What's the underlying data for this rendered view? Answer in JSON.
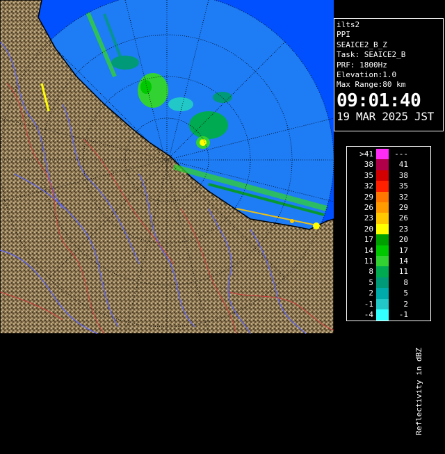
{
  "header": {
    "lines": [
      "ilts2",
      "PPI",
      "SEAICE2_B_Z",
      "Task: SEAICE2_B",
      "PRF: 1800Hz",
      "Elevation:1.0",
      "Max Range:80 km"
    ],
    "time": "09:01:40",
    "date": "19 MAR 2025 JST"
  },
  "legend": {
    "unit_label": "Reflectivity in dBZ",
    "rows": [
      {
        "low": ">41",
        "high": "---",
        "color": "#ff2cf5"
      },
      {
        "low": "38",
        "high": "41",
        "color": "#b0004a"
      },
      {
        "low": "35",
        "high": "38",
        "color": "#d20000"
      },
      {
        "low": "32",
        "high": "35",
        "color": "#ff2000"
      },
      {
        "low": "29",
        "high": "32",
        "color": "#ff7700"
      },
      {
        "low": "26",
        "high": "29",
        "color": "#ff9a00"
      },
      {
        "low": "23",
        "high": "26",
        "color": "#ffc800"
      },
      {
        "low": "20",
        "high": "23",
        "color": "#ffff00"
      },
      {
        "low": "17",
        "high": "20",
        "color": "#00a000"
      },
      {
        "low": "14",
        "high": "17",
        "color": "#00c800"
      },
      {
        "low": "11",
        "high": "14",
        "color": "#32d232"
      },
      {
        "low": "8",
        "high": "11",
        "color": "#00aa50"
      },
      {
        "low": "5",
        "high": "8",
        "color": "#009a78"
      },
      {
        "low": "2",
        "high": "5",
        "color": "#00aaaa"
      },
      {
        "low": "-1",
        "high": "2",
        "color": "#22c8c8"
      },
      {
        "low": "-4",
        "high": "-1",
        "color": "#33ffff"
      }
    ]
  },
  "colors": {
    "background": "#000000",
    "sea": "#0050ff",
    "radar_disc": "#1e7cf5",
    "land": "#8f7a4f",
    "coastline": "#000000",
    "rivers": "#5a63ff",
    "boundaries": "#d23c3c",
    "range_rings": "#000000"
  }
}
